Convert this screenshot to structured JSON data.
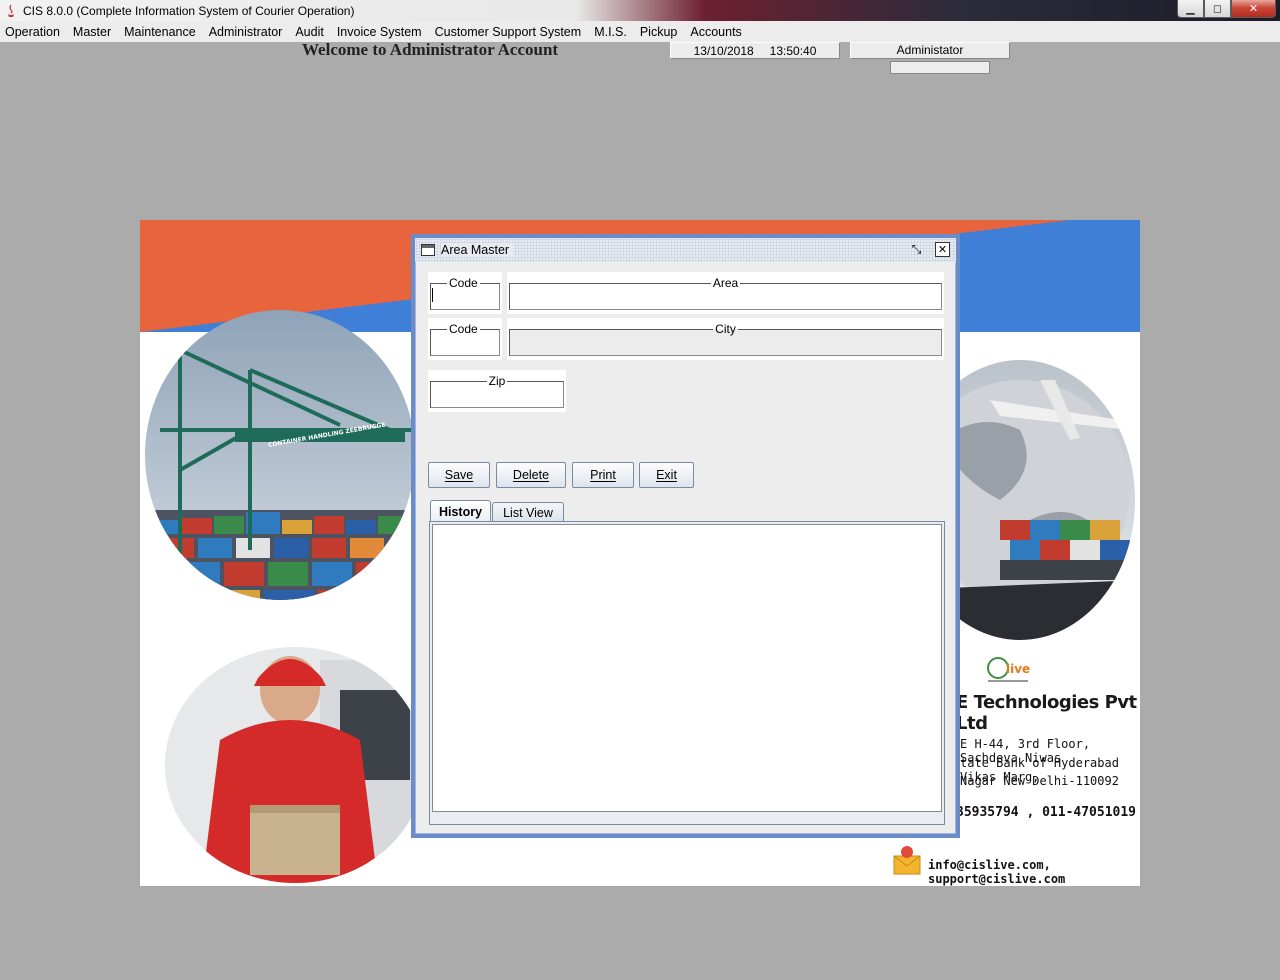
{
  "window": {
    "title": "CIS 8.0.0 (Complete Information System of Courier Operation)",
    "controls": {
      "minimize": "▁",
      "maximize": "◻",
      "close": "✕"
    }
  },
  "menu": [
    "Operation",
    "Master",
    "Maintenance",
    "Administrator",
    "Audit",
    "Invoice System",
    "Customer Support System",
    "M.I.S.",
    "Pickup",
    "Accounts"
  ],
  "header": {
    "welcome": "Welcome to Administrator Account",
    "date": "13/10/2018",
    "time": "13:50:40",
    "user": "Administator"
  },
  "banner": {
    "company": "E Technologies Pvt Ltd",
    "address_lines": [
      "E H-44, 3rd Floor, Sachdeva Niwas",
      "tate Bank of Hyderabad Vikas Marg,",
      "Nagar New Delhi-110092"
    ],
    "phone": "35935794 , 011-47051019",
    "email": "info@cislive.com, support@cislive.com",
    "crane_sign": "CONTAINER HANDLING ZEEBRUGGE",
    "colors": {
      "orange": "#e8643c",
      "blue": "#3f7fd8"
    }
  },
  "area_master": {
    "title": "Area Master",
    "fields": {
      "area_code_label": "Code",
      "area_label": "Area",
      "city_code_label": "Code",
      "city_label": "City",
      "zip_label": "Zip"
    },
    "buttons": {
      "save": "Save",
      "delete": "Delete",
      "print": "Print",
      "exit": "Exit"
    },
    "tabs": {
      "history": "History",
      "list_view": "List View"
    }
  }
}
